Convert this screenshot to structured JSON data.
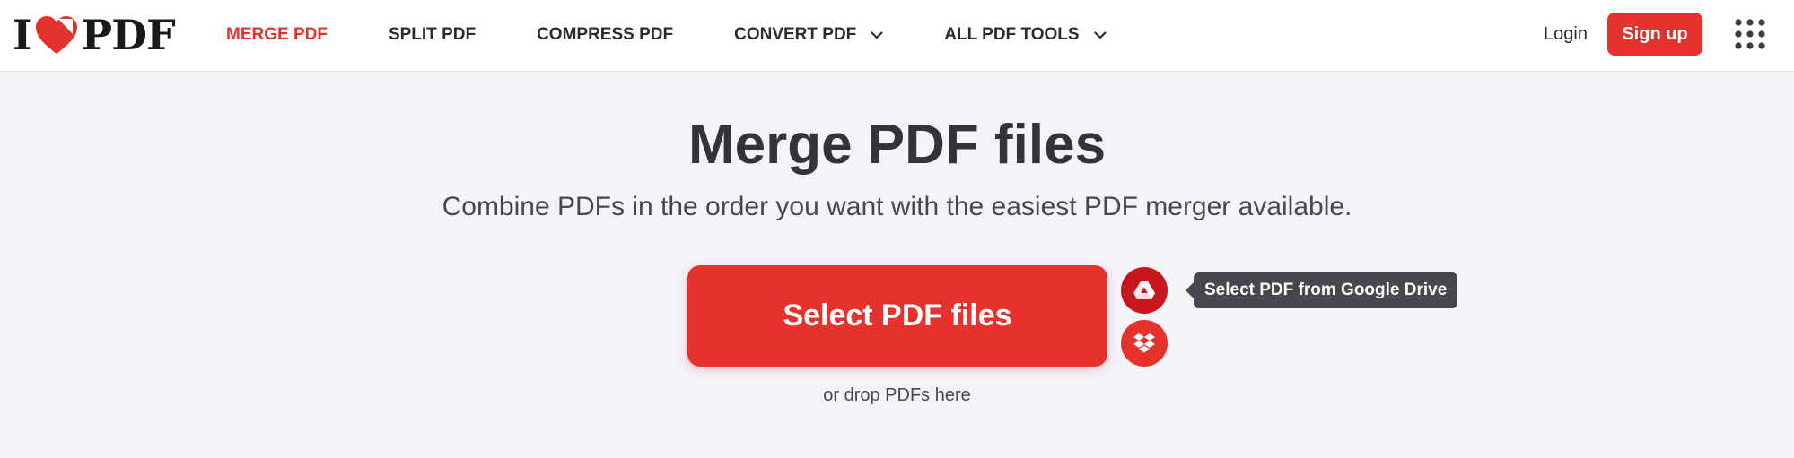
{
  "header": {
    "logo": {
      "prefix": "I",
      "suffix": "PDF",
      "icon": "heart-icon",
      "accent_color": "#e5322d"
    },
    "nav": [
      {
        "label": "MERGE PDF",
        "active": true
      },
      {
        "label": "SPLIT PDF",
        "active": false
      },
      {
        "label": "COMPRESS PDF",
        "active": false
      },
      {
        "label": "CONVERT PDF",
        "active": false,
        "dropdown": true
      },
      {
        "label": "ALL PDF TOOLS",
        "active": false,
        "dropdown": true
      }
    ],
    "login_label": "Login",
    "signup_label": "Sign up",
    "apps_icon": "grid-menu-icon"
  },
  "main": {
    "title": "Merge PDF files",
    "subtitle": "Combine PDFs in the order you want with the easiest PDF merger available.",
    "select_button_label": "Select PDF files",
    "google_drive_icon": "google-drive-icon",
    "dropbox_icon": "dropbox-icon",
    "tooltip": "Select PDF from Google Drive",
    "drop_hint": "or drop PDFs here"
  },
  "colors": {
    "brand": "#e5322d",
    "brand_dark": "#c8161d",
    "background": "#f4f3f8",
    "text": "#33333b",
    "tooltip_bg": "#47474f"
  }
}
